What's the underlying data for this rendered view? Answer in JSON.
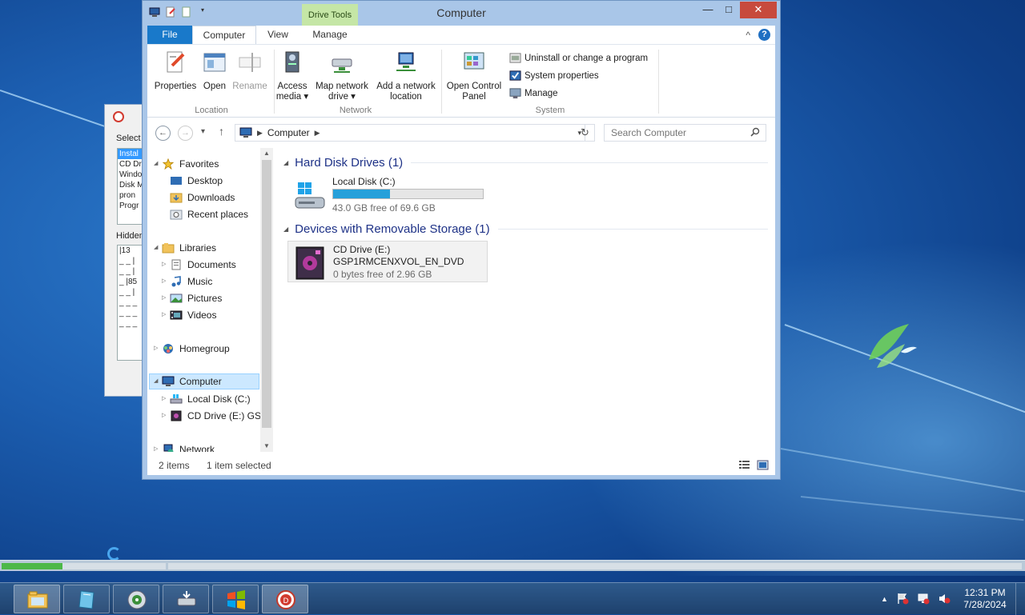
{
  "window": {
    "title": "Computer",
    "contextual_tab": "Drive Tools",
    "controls": {
      "minimize": "—",
      "maximize": "□",
      "close": "✕"
    }
  },
  "ribbon": {
    "tabs": [
      "File",
      "Computer",
      "View",
      "Manage"
    ],
    "location": {
      "label": "Location",
      "properties": "Properties",
      "open": "Open",
      "rename": "Rename"
    },
    "network": {
      "label": "Network",
      "access_media": [
        "Access",
        "media ▾"
      ],
      "map_network_drive": [
        "Map network",
        "drive ▾"
      ],
      "add_network_location": [
        "Add a network",
        "location"
      ]
    },
    "system": {
      "label": "System",
      "open_control_panel": [
        "Open Control",
        "Panel"
      ],
      "uninstall": "Uninstall or change a program",
      "system_properties": "System properties",
      "manage": "Manage"
    },
    "collapse_glyph": "^",
    "help_glyph": "?"
  },
  "address": {
    "path": "Computer",
    "search_placeholder": "Search Computer"
  },
  "nav_tree": {
    "favorites": "Favorites",
    "desktop": "Desktop",
    "downloads": "Downloads",
    "recent": "Recent places",
    "libraries": "Libraries",
    "documents": "Documents",
    "music": "Music",
    "pictures": "Pictures",
    "videos": "Videos",
    "homegroup": "Homegroup",
    "computer": "Computer",
    "local_disk": "Local Disk (C:)",
    "cd_drive": "CD Drive (E:) GSP",
    "network": "Network"
  },
  "content": {
    "hard_disk_header": "Hard Disk Drives (1)",
    "removable_header": "Devices with Removable Storage (1)",
    "local_disk": {
      "name": "Local Disk (C:)",
      "free": "43.0 GB free of 69.6 GB",
      "used_fraction": 0.382
    },
    "cd_drive": {
      "name": "CD Drive (E:)",
      "label": "GSP1RMCENXVOL_EN_DVD",
      "free": "0 bytes free of 2.96 GB"
    }
  },
  "status": {
    "items": "2 items",
    "selected": "1 item selected"
  },
  "background_dialog": {
    "select_label": "Select",
    "list": [
      "Instal",
      "CD Dr",
      "Windo",
      "Disk M",
      "pron",
      "Progr"
    ],
    "hidden_label": "Hidden",
    "hidden_list": [
      "|13",
      "",
      "_ _ |",
      "_ _ |",
      "_ |85",
      "_ _ |",
      "_ _ _",
      "_ _ _",
      "_ _ _"
    ]
  },
  "setup_progress_fraction": 0.37,
  "taskbar": {
    "time": "12:31 PM",
    "date": "7/28/2024",
    "tray_expand": "▲"
  },
  "colors": {
    "accent": "#1979ca",
    "selection": "#cce8ff",
    "capacity_fill": "#26a0da",
    "close_button": "#c74a3d"
  }
}
